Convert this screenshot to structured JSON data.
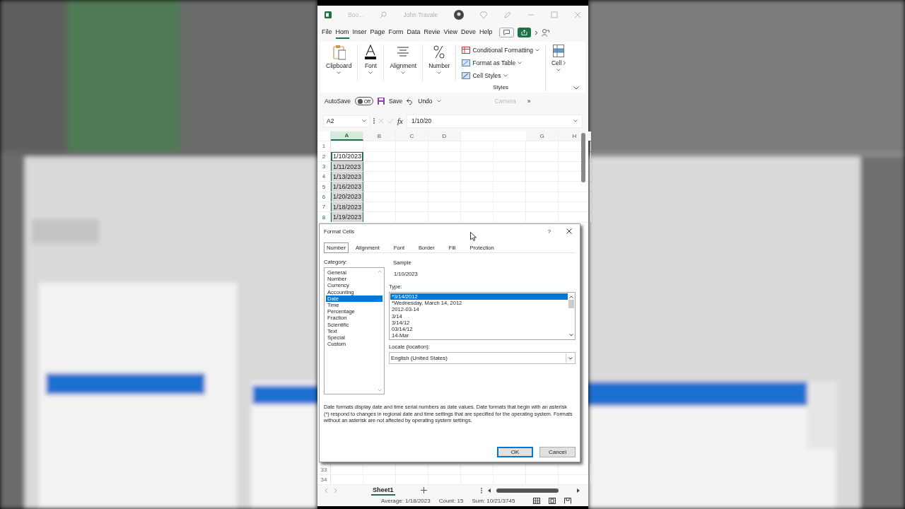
{
  "title_bar": {
    "file_name": "Boo...",
    "user": "John Travale"
  },
  "ribbon_tabs": [
    {
      "label": "File",
      "selected": false
    },
    {
      "label": "Hom",
      "selected": true
    },
    {
      "label": "Inser",
      "selected": false
    },
    {
      "label": "Page",
      "selected": false
    },
    {
      "label": "Form",
      "selected": false
    },
    {
      "label": "Data",
      "selected": false
    },
    {
      "label": "Revie",
      "selected": false
    },
    {
      "label": "View",
      "selected": false
    },
    {
      "label": "Deve",
      "selected": false
    },
    {
      "label": "Help",
      "selected": false
    }
  ],
  "ribbon_groups": [
    {
      "label": "Clipboard",
      "kind": "clipboard"
    },
    {
      "label": "Font",
      "kind": "font"
    },
    {
      "label": "Alignment",
      "kind": "alignment"
    },
    {
      "label": "Number",
      "kind": "number"
    }
  ],
  "styles_group": {
    "items": [
      {
        "label": "Conditional Formatting",
        "kind": "conditional"
      },
      {
        "label": "Format as Table",
        "kind": "table"
      },
      {
        "label": "Cell Styles",
        "kind": "styles"
      }
    ],
    "label": "Styles"
  },
  "cells_group": {
    "label": "Cell"
  },
  "quick_access": {
    "autosave_label": "AutoSave",
    "autosave": {
      "label": "Off",
      "on": false
    },
    "save": "Save",
    "undo": "Undo",
    "camera": "Camera",
    "overflow": "»"
  },
  "formula_bar": {
    "name_box": "A2",
    "function_label": "fx",
    "value": "1/10/20"
  },
  "columns": [
    {
      "label": "A",
      "selected": true
    },
    {
      "label": "B",
      "selected": false
    },
    {
      "label": "C",
      "selected": false
    },
    {
      "label": "D",
      "selected": false
    },
    {
      "kind": "blank"
    },
    {
      "kind": "blank"
    },
    {
      "label": "G",
      "selected": false
    },
    {
      "label": "H",
      "selected": false
    }
  ],
  "rows": [
    {
      "number": "1",
      "selected": false,
      "active": false
    },
    {
      "number": "2",
      "value": "1/10/2023",
      "selected": true,
      "active": true
    },
    {
      "number": "3",
      "value": "1/11/2023",
      "selected": true,
      "active": false
    },
    {
      "number": "4",
      "value": "1/13/2023",
      "selected": true,
      "active": false
    },
    {
      "number": "5",
      "value": "1/16/2023",
      "selected": true,
      "active": false
    },
    {
      "number": "6",
      "value": "1/20/2023",
      "selected": true,
      "active": false
    },
    {
      "number": "7",
      "value": "1/18/2023",
      "selected": true,
      "active": false
    },
    {
      "number": "8",
      "value": "1/19/2023",
      "selected": true,
      "active": false
    }
  ],
  "lower_rows": [
    "33",
    "34"
  ],
  "sheet_tabs": [
    {
      "label": "Sheet1",
      "selected": true
    }
  ],
  "status_bar": [
    "Average: 1/18/2023",
    "Count: 15",
    "Sum: 10/21/3745"
  ],
  "dialog": {
    "title": "Format Cells",
    "help": "?",
    "tabs": [
      {
        "label": "Number",
        "selected": true
      },
      {
        "label": "Alignment",
        "selected": false
      },
      {
        "label": "Font",
        "selected": false
      },
      {
        "label": "Border",
        "selected": false
      },
      {
        "label": "Fill",
        "selected": false
      },
      {
        "label": "Protection",
        "selected": false
      }
    ],
    "category_label": "Category:",
    "categories": [
      {
        "label": "General",
        "selected": false
      },
      {
        "label": "Number",
        "selected": false
      },
      {
        "label": "Currency",
        "selected": false
      },
      {
        "label": "Accounting",
        "selected": false
      },
      {
        "label": "Date",
        "selected": true
      },
      {
        "label": "Time",
        "selected": false
      },
      {
        "label": "Percentage",
        "selected": false
      },
      {
        "label": "Fraction",
        "selected": false
      },
      {
        "label": "Scientific",
        "selected": false
      },
      {
        "label": "Text",
        "selected": false
      },
      {
        "label": "Special",
        "selected": false
      },
      {
        "label": "Custom",
        "selected": false
      }
    ],
    "sample_label": "Sample",
    "sample": "1/10/2023",
    "type_label": "Type:",
    "types": [
      {
        "label": "*3/14/2012",
        "selected": true
      },
      {
        "label": "*Wednesday, March 14, 2012",
        "selected": false
      },
      {
        "label": "2012-03-14",
        "selected": false
      },
      {
        "label": "3/14",
        "selected": false
      },
      {
        "label": "3/14/12",
        "selected": false
      },
      {
        "label": "03/14/12",
        "selected": false
      },
      {
        "label": "14-Mar",
        "selected": false
      }
    ],
    "locale_label": "Locale (location):",
    "locale": "English (United States)",
    "description": "Date formats display date and time serial numbers as date values.  Date formats that begin with an asterisk (*) respond to changes in regional date and time settings that are specified for the operating system. Formats without an asterisk are not affected by operating system settings.",
    "buttons": [
      {
        "label": "OK",
        "kind": "default"
      },
      {
        "label": "Cancel",
        "kind": "normal"
      }
    ]
  }
}
